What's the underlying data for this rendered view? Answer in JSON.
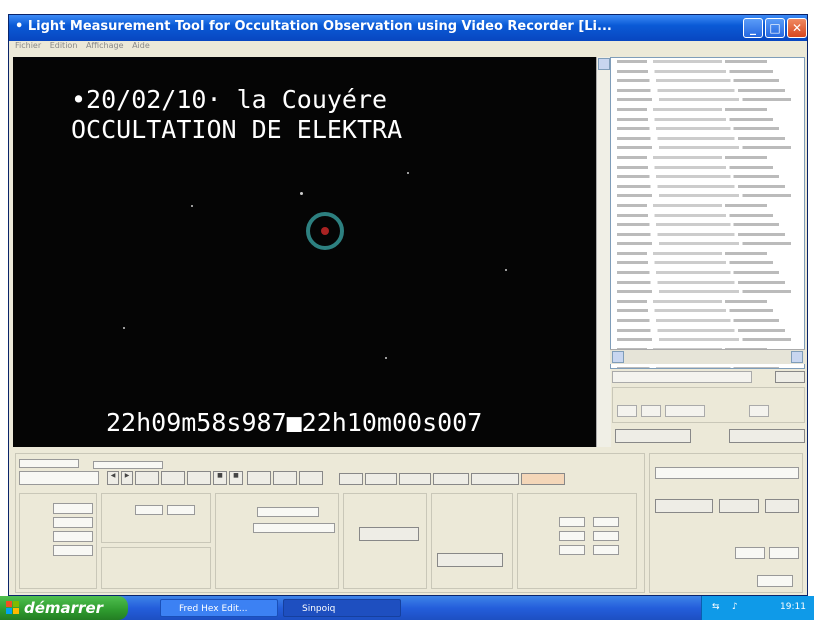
{
  "window": {
    "title": "Light Measurement Tool for Occultation Observation using Video Recorder [Li..."
  },
  "menubar": {
    "items": [
      "Fichier",
      "Edition",
      "Affichage",
      "Aide"
    ]
  },
  "video": {
    "line1": "•20/02/10· la Couyére",
    "line2": "OCCULTATION DE ELEKTRA",
    "timestamp": "22h09m58s987■22h10m00s007"
  },
  "taskbar": {
    "start_label": "démarrer",
    "tasks": [
      "Fred Hex Edit...",
      "Sinpoiq"
    ],
    "clock": "19:11"
  },
  "colors": {
    "titlebar": "#0a5ad6",
    "video_bg": "#050505",
    "ring": "#2d8080",
    "taskbar": "#245edb",
    "start": "#2e9a2e"
  }
}
